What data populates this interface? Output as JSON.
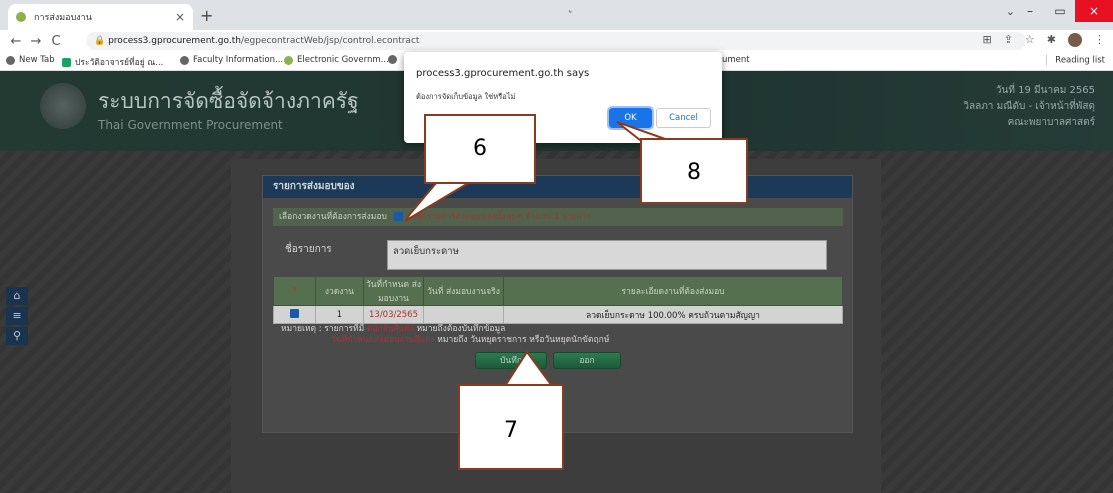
{
  "browser": {
    "tab_title": "การส่งมอบงาน",
    "tab_close": "×",
    "new_tab": "+",
    "top_hint": "ู",
    "window": {
      "minimize": "–",
      "restore": "▭",
      "close": "×",
      "tabs_menu": "⌄"
    },
    "nav": {
      "back": "←",
      "forward": "→",
      "reload": "C"
    },
    "url_host": "process3.gprocurement.go.th",
    "url_path": "/egpecontractWeb/jsp/control.econtract",
    "bookmarks": [
      {
        "label": "New Tab",
        "icon": "globe-icon"
      },
      {
        "label": "ประวัติอาจารย์ที่อยู่ ณ...",
        "icon": "sheet-icon"
      },
      {
        "label": "Faculty Information...",
        "icon": "globe-icon"
      },
      {
        "label": "Electronic Governm...",
        "icon": "leaf-icon"
      },
      {
        "label": "ument",
        "icon": ""
      }
    ],
    "reading_list": "Reading list"
  },
  "banner": {
    "title_th": "ระบบการจัดซื้อจัดจ้างภาครัฐ",
    "title_en": "Thai Government Procurement",
    "date": "วันที่ 19 มีนาคม 2565",
    "user": "วิลลภา มณีดับ - เจ้าหน้าที่พัสดุ",
    "org": "คณะพยาบาลศาสตร์"
  },
  "panel": {
    "title": "รายการส่งมอบของ",
    "select_label": "เลือกงวดงานที่ต้องการส่งมอบ",
    "select_all_text": "เลือกรายการส่งมอบของทั้งหมด จำนวน 1 รายการ",
    "item_label": "ชื่อรายการ",
    "item_value": "ลวดเย็บกระดาษ",
    "columns": [
      "*",
      "งวดงาน",
      "วันที่กำหนด ส่งมอบงาน",
      "วันที่ ส่งมอบงานจริง",
      "รายละเอียดงานที่ต้องส่งมอบ"
    ],
    "rows": [
      {
        "installment": "1",
        "due_date": "13/03/2565",
        "actual_date": "",
        "detail": "ลวดเย็บกระดาษ 100.00% ครบถ้วนตามสัญญา"
      }
    ],
    "note_prefix": "หมายเหตุ : รายการที่มี",
    "note_red1": "ดอกจันสีแดง",
    "note_mid": "หมายถึงต้องบันทึกข้อมูล",
    "note_red2": "วันที่กำหนดส่งมอบงานสีแดง",
    "note_end": "หมายถึง วันหยุดราชการ หรือวันหยุดนักขัตฤกษ์",
    "save_button": "บันทึก",
    "exit_button": "ออก"
  },
  "sidebar": {
    "home": "⌂",
    "menu": "≡",
    "search": "⚲"
  },
  "dialog": {
    "origin": "process3.gprocurement.go.th says",
    "message": "ต้องการจัดเก็บข้อมูล ใช่หรือไม่",
    "ok": "OK",
    "cancel": "Cancel"
  },
  "callouts": [
    "6",
    "7",
    "8"
  ],
  "colors": {
    "dialog_ok": "#1a73e8",
    "callout_border": "#8b3a1e",
    "header": "#1c3a57"
  }
}
